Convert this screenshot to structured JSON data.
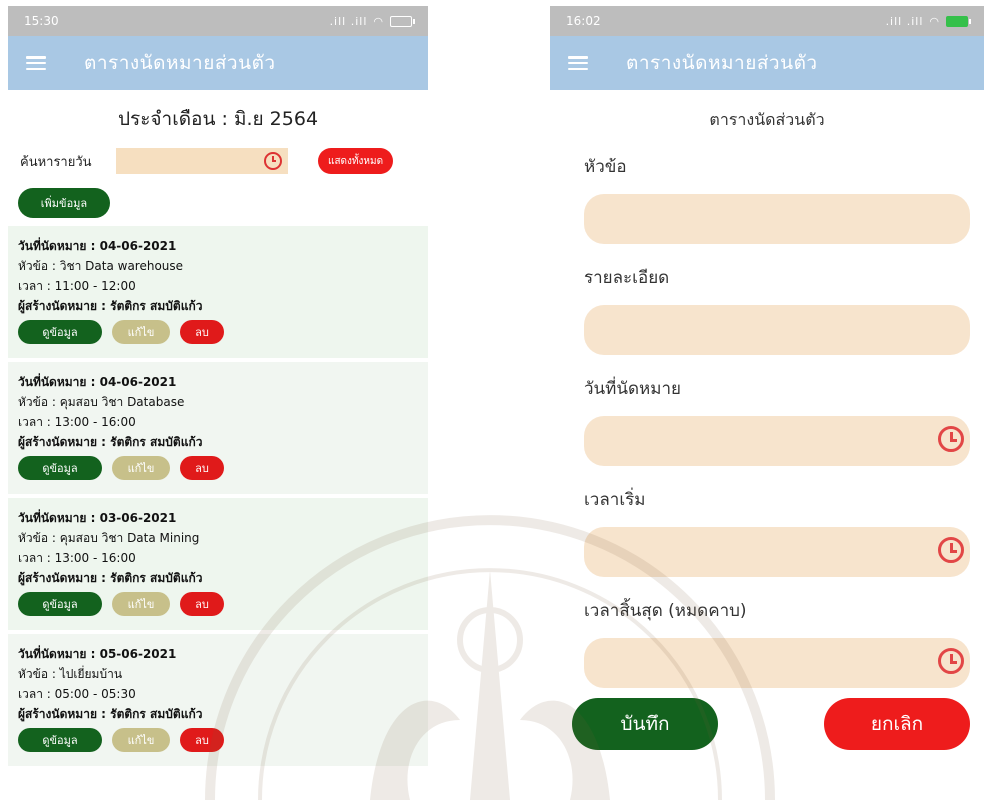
{
  "left": {
    "status": {
      "time": "15:30",
      "signal": ".ill .ill"
    },
    "appbar": {
      "title": "ตารางนัดหมายส่วนตัว"
    },
    "month_label": "ประจำเดือน :  มิ.ย 2564",
    "search": {
      "label": "ค้นหารายวัน",
      "value": "",
      "show_all_label": "แสดงทั้งหมด"
    },
    "add_label": "เพิ่มข้อมูล",
    "appointments": [
      {
        "date": "วันที่นัดหมาย : 04-06-2021",
        "topic": "หัวข้อ : วิชา Data warehouse",
        "time": "เวลา : 11:00 - 12:00",
        "creator": "ผู้สร้างนัดหมาย : รัตติกร สมบัติแก้ว"
      },
      {
        "date": "วันที่นัดหมาย : 04-06-2021",
        "topic": "หัวข้อ : คุมสอบ วิชา Database",
        "time": "เวลา : 13:00 - 16:00",
        "creator": "ผู้สร้างนัดหมาย : รัตติกร สมบัติแก้ว"
      },
      {
        "date": "วันที่นัดหมาย : 03-06-2021",
        "topic": "หัวข้อ : คุมสอบ วิชา Data Mining",
        "time": "เวลา : 13:00 - 16:00",
        "creator": "ผู้สร้างนัดหมาย : รัตติกร สมบัติแก้ว"
      },
      {
        "date": "วันที่นัดหมาย : 05-06-2021",
        "topic": "หัวข้อ : ไปเยี่ยมบ้าน",
        "time": "เวลา : 05:00 - 05:30",
        "creator": "ผู้สร้างนัดหมาย : รัตติกร สมบัติแก้ว"
      }
    ],
    "card_buttons": {
      "view": "ดูข้อมูล",
      "edit": "แก้ไข",
      "delete": "ลบ"
    }
  },
  "right": {
    "status": {
      "time": "16:02",
      "signal": ".ill .ill"
    },
    "appbar": {
      "title": "ตารางนัดหมายส่วนตัว"
    },
    "subtitle": "ตารางนัดส่วนตัว",
    "fields": {
      "topic": {
        "label": "หัวข้อ",
        "value": ""
      },
      "detail": {
        "label": "รายละเอียด",
        "value": ""
      },
      "date": {
        "label": "วันที่นัดหมาย",
        "value": ""
      },
      "start": {
        "label": "เวลาเริ่ม",
        "value": ""
      },
      "end": {
        "label": "เวลาสิ้นสุด (หมดคาบ)",
        "value": ""
      }
    },
    "save_label": "บันทึก",
    "cancel_label": "ยกเลิก"
  },
  "colors": {
    "appbar": "#a9c8e4",
    "green": "#13621e",
    "red": "#ee1c1c",
    "input": "#f7e4cd",
    "edit": "#c7c08a"
  }
}
